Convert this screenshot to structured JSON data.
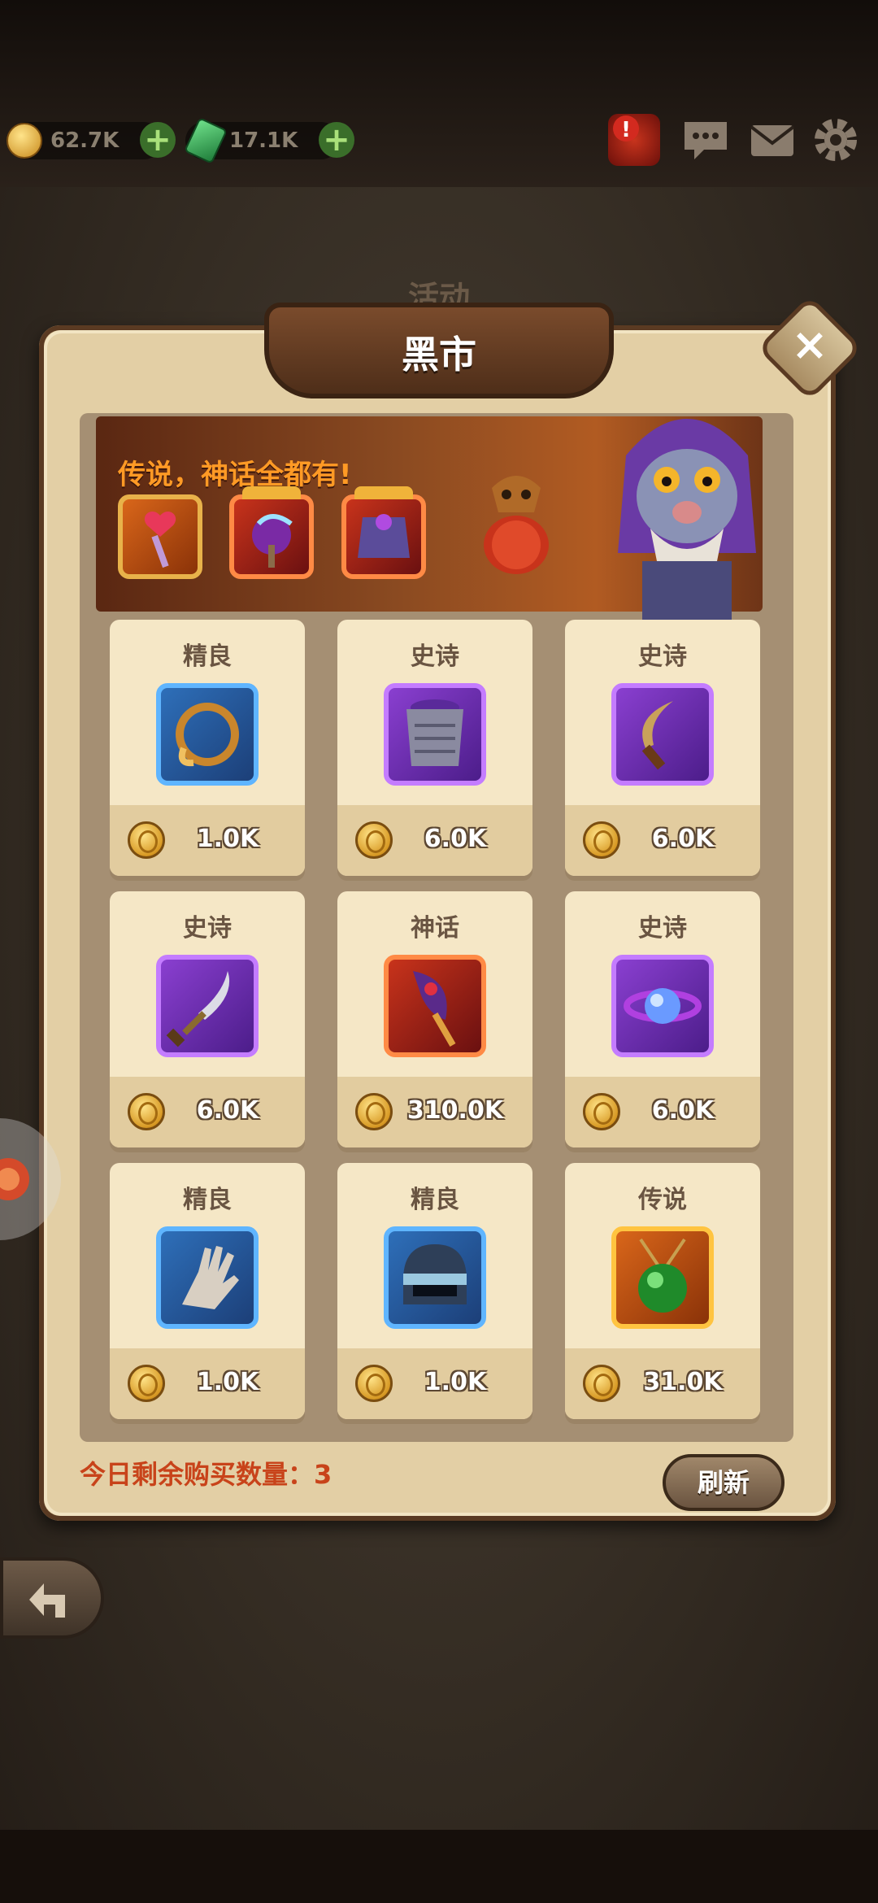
{
  "resources": {
    "gold": "62.7K",
    "gems": "17.1K"
  },
  "header": {
    "activity_tab": "活动",
    "title": "黑市",
    "close_label": "×"
  },
  "banner": {
    "slogan": "传说，神话全都有!"
  },
  "shop_items": [
    {
      "tier": "精良",
      "price": "1.0K",
      "icon": "ring-icon",
      "frame": "blue"
    },
    {
      "tier": "史诗",
      "price": "6.0K",
      "icon": "armor-icon",
      "frame": "purple"
    },
    {
      "tier": "史诗",
      "price": "6.0K",
      "icon": "dagger-icon",
      "frame": "purple"
    },
    {
      "tier": "史诗",
      "price": "6.0K",
      "icon": "sword-icon",
      "frame": "purple"
    },
    {
      "tier": "神话",
      "price": "310.0K",
      "icon": "staff-icon",
      "frame": "red"
    },
    {
      "tier": "史诗",
      "price": "6.0K",
      "icon": "orb-icon",
      "frame": "purple"
    },
    {
      "tier": "精良",
      "price": "1.0K",
      "icon": "gauntlet-icon",
      "frame": "blue"
    },
    {
      "tier": "精良",
      "price": "1.0K",
      "icon": "helmet-icon",
      "frame": "blue"
    },
    {
      "tier": "传说",
      "price": "31.0K",
      "icon": "amulet-icon",
      "frame": "orange"
    }
  ],
  "footer": {
    "remaining_label": "今日剩余购买数量：3",
    "refresh_label": "刷新"
  },
  "colors": {
    "panel": "#e3cfa5",
    "accent_orange": "#c8431a",
    "rarity_blue": "#5fb5ff",
    "rarity_purple": "#c47cff",
    "rarity_red": "#ff8a45",
    "rarity_orange": "#ffc440"
  }
}
